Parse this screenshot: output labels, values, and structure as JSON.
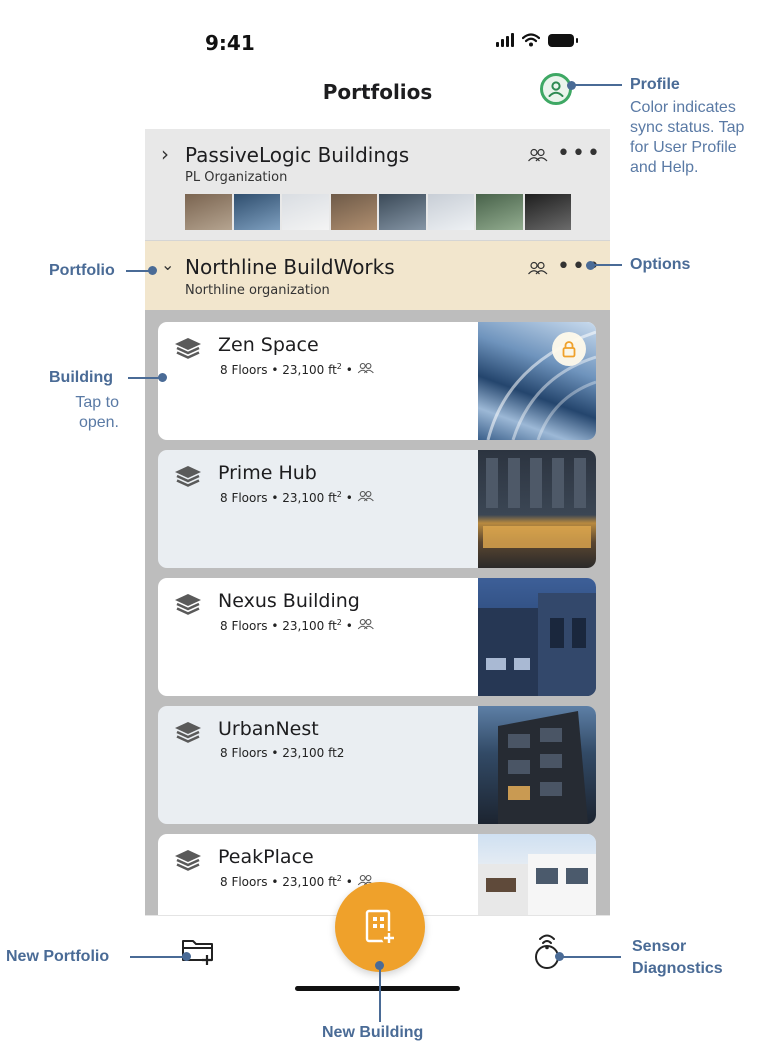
{
  "status_bar": {
    "time": "9:41"
  },
  "header": {
    "title": "Portfolios"
  },
  "portfolios": [
    {
      "name": "PassiveLogic Buildings",
      "subtitle": "PL Organization",
      "expanded": false
    },
    {
      "name": "Northline BuildWorks",
      "subtitle": "Northline organization",
      "expanded": true
    }
  ],
  "buildings": [
    {
      "name": "Zen Space",
      "meta": "8 Floors • 23,100 ft",
      "superscript": "2",
      "suffix": " •",
      "shared_icon": "people-icon",
      "locked": true
    },
    {
      "name": "Prime Hub",
      "meta": "8 Floors • 23,100 ft",
      "superscript": "2",
      "suffix": " •",
      "shared_icon": "people-icon",
      "locked": false
    },
    {
      "name": "Nexus Building",
      "meta": "8 Floors • 23,100 ft",
      "superscript": "2",
      "suffix": " •",
      "shared_icon": "people-icon",
      "locked": false
    },
    {
      "name": "UrbanNest",
      "meta": "8 Floors • 23,100 ft2",
      "superscript": "",
      "suffix": "",
      "shared_icon": "",
      "locked": false
    },
    {
      "name": "PeakPlace",
      "meta": "8 Floors • 23,100 ft",
      "superscript": "2",
      "suffix": " •",
      "shared_icon": "people-icon",
      "locked": false
    }
  ],
  "callouts": {
    "profile": {
      "title": "Profile",
      "lines": [
        "Color indicates",
        "sync status. Tap",
        "for User Profile",
        "and Help."
      ]
    },
    "options": {
      "title": "Options"
    },
    "portfolio": {
      "title": "Portfolio"
    },
    "building": {
      "title": "Building",
      "lines": [
        "Tap to",
        "open."
      ]
    },
    "new_portfolio": {
      "title": "New Portfolio"
    },
    "sensor": {
      "title_line1": "Sensor",
      "title_line2": "Diagnostics"
    },
    "new_building": {
      "title": "New Building"
    }
  },
  "icons": {
    "profile": "person-circle-icon",
    "options": "ellipsis-icon",
    "shared": "people-icon",
    "building_type": "layers-icon",
    "lock": "lock-icon",
    "new_portfolio": "folder-plus-icon",
    "new_building": "building-plus-icon",
    "sensor": "sensor-icon"
  },
  "colors": {
    "accent": "#efa12b",
    "profile_sync": "#3ea864",
    "selected_portfolio_bg": "#f2e6cd",
    "callout": "#4a6b96"
  }
}
